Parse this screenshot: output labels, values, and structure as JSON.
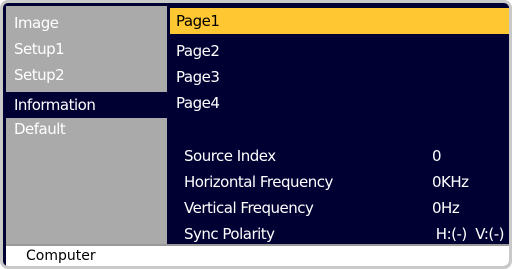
{
  "sidebar": {
    "items": [
      {
        "label": "Image"
      },
      {
        "label": "Setup1"
      },
      {
        "label": "Setup2"
      },
      {
        "label": "Information"
      },
      {
        "label": "Default"
      }
    ]
  },
  "pages": [
    {
      "label": "Page1"
    },
    {
      "label": "Page2"
    },
    {
      "label": "Page3"
    },
    {
      "label": "Page4"
    }
  ],
  "info": {
    "source_index": {
      "label": "Source Index",
      "value": "0"
    },
    "horizontal_frequency": {
      "label": "Horizontal Frequency",
      "value": "0KHz"
    },
    "vertical_frequency": {
      "label": "Vertical Frequency",
      "value": "0Hz"
    },
    "sync_polarity": {
      "label": "Sync Polarity",
      "value": "H:(-)  V:(-)"
    }
  },
  "status": {
    "source": "Computer"
  },
  "colors": {
    "background": "#000033",
    "sidebar": "#aaaaaa",
    "selected": "#ffc832",
    "frame": "#c9c9c9"
  }
}
